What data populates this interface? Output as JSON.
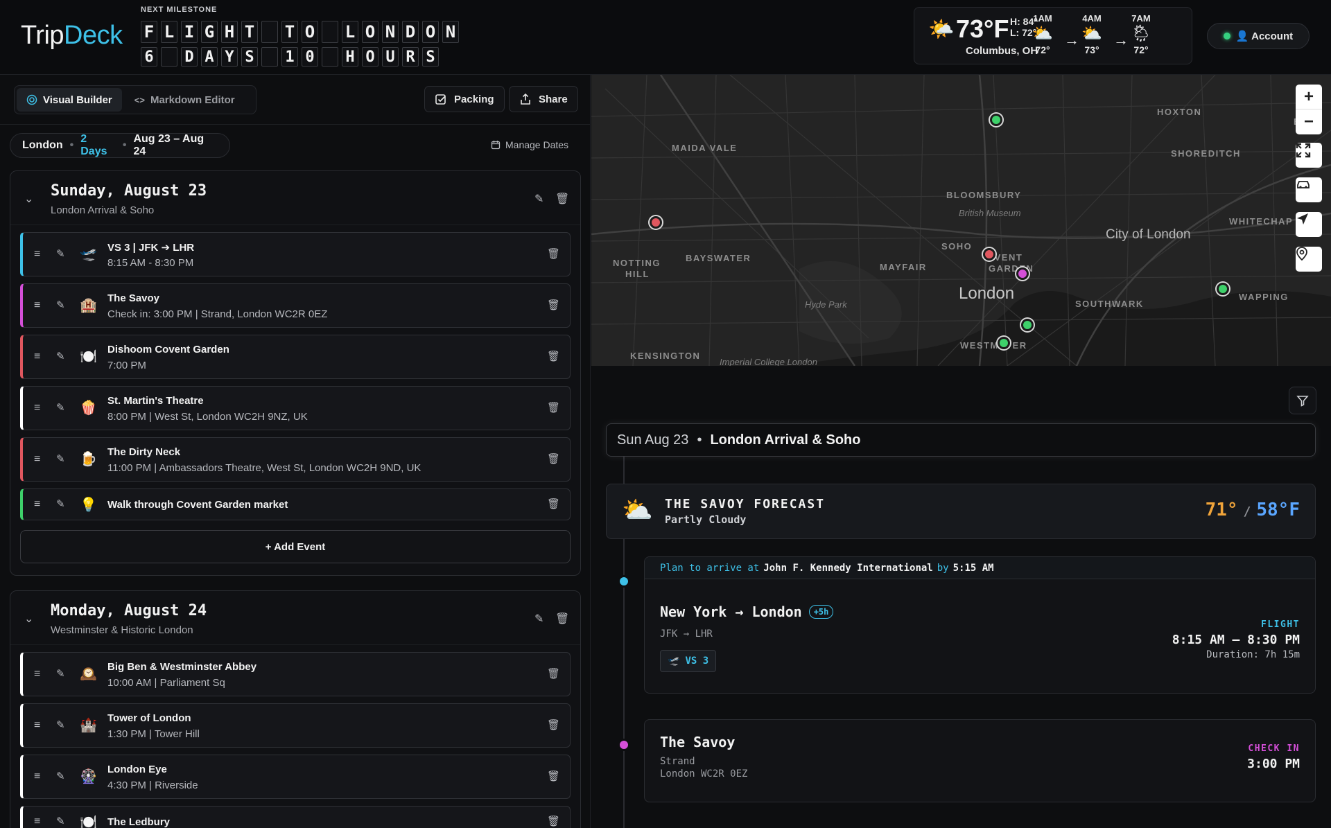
{
  "header": {
    "logo_trip": "Trip",
    "logo_deck": "Deck",
    "milestone_label": "NEXT MILESTONE",
    "milestone_line1": [
      "F",
      "L",
      "I",
      "G",
      "H",
      "T",
      " ",
      "T",
      "O",
      " ",
      "L",
      "O",
      "N",
      "D",
      "O",
      "N"
    ],
    "milestone_line2": [
      "6",
      " ",
      "D",
      "A",
      "Y",
      "S",
      " ",
      "1",
      "0",
      " ",
      "H",
      "O",
      "U",
      "R",
      "S"
    ]
  },
  "weather": {
    "icon": "partly-sunny-icon",
    "temp": "73°F",
    "high": "H: 84°",
    "low": "L: 72°",
    "city": "Columbus, OH",
    "hourly": [
      {
        "time": "1AM",
        "icon": "⛅",
        "temp": "72°"
      },
      {
        "time": "4AM",
        "icon": "⛅",
        "temp": "73°"
      },
      {
        "time": "7AM",
        "icon": "🌦",
        "temp": "72°"
      }
    ],
    "arrow": "→"
  },
  "account": {
    "label": "👤 Account",
    "status_color": "#35d07f"
  },
  "toolbar": {
    "visual_builder": "Visual Builder",
    "markdown_editor": "Markdown Editor",
    "packing": "Packing",
    "share": "Share"
  },
  "trip": {
    "city": "London",
    "days": "2 Days",
    "dates": "Aug 23 – Aug 24",
    "manage_dates": "Manage Dates"
  },
  "days": [
    {
      "title": "Sunday, August 23",
      "subtitle": "London Arrival & Soho",
      "events": [
        {
          "icon": "🛫",
          "title": "VS 3 | JFK ➔ LHR",
          "sub": "8:15 AM - 8:30 PM",
          "color": "#3ec1e8"
        },
        {
          "icon": "🏨",
          "title": "The Savoy",
          "sub": "Check in: 3:00 PM | Strand, London WC2R 0EZ",
          "color": "#d44fd8"
        },
        {
          "icon": "🍽️",
          "title": "Dishoom Covent Garden",
          "sub": "7:00 PM",
          "color": "#e0575f"
        },
        {
          "icon": "🍿",
          "title": "St. Martin's Theatre",
          "sub": "8:00 PM | West St, London WC2H 9NZ, UK",
          "color": "#ffffff"
        },
        {
          "icon": "🍺",
          "title": "The Dirty Neck",
          "sub": "11:00 PM | Ambassadors Theatre, West St, London WC2H 9ND, UK",
          "color": "#e0575f"
        },
        {
          "icon": "💡",
          "title": "Walk through Covent Garden market",
          "sub": "",
          "color": "#3ed06a"
        }
      ],
      "add_event": "+ Add Event"
    },
    {
      "title": "Monday, August 24",
      "subtitle": "Westminster & Historic London",
      "events": [
        {
          "icon": "🕰️",
          "title": "Big Ben & Westminster Abbey",
          "sub": "10:00 AM | Parliament Sq",
          "color": "#ffffff"
        },
        {
          "icon": "🏰",
          "title": "Tower of London",
          "sub": "1:30 PM | Tower Hill",
          "color": "#ffffff"
        },
        {
          "icon": "🎡",
          "title": "London Eye",
          "sub": "4:30 PM | Riverside",
          "color": "#ffffff"
        },
        {
          "icon": "🍽️",
          "title": "The Ledbury",
          "sub": "",
          "color": "#ffffff"
        }
      ]
    }
  ],
  "map": {
    "labels": {
      "maida_vale": "MAIDA VALE",
      "hoxton": "HOXTON",
      "shoreditch": "SHOREDITCH",
      "bloomsbury": "BLOOMSBURY",
      "british_museum": "British Museum",
      "notting_hill_1": "NOTTING",
      "notting_hill_2": "HILL",
      "bayswater": "BAYSWATER",
      "soho": "SOHO",
      "covent_1": "OVENT",
      "covent_2": "GARDEN",
      "mayfair": "MAYFAIR",
      "city_of_london": "City of London",
      "whitechapel": "WHITECHAP",
      "hyde_park": "Hyde Park",
      "london": "London",
      "southwark": "SOUTHWARK",
      "wapping": "WAPPING",
      "kensington": "KENSINGTON",
      "westminster": "WESTMI TER",
      "imperial": "Imperial College London",
      "edge_b": "B"
    },
    "zoom_in": "+",
    "zoom_out": "−",
    "colors": {
      "green": "#3ed06a",
      "red": "#e0575f",
      "magenta": "#d44fd8"
    }
  },
  "timeline": {
    "date": "Sun Aug 23",
    "bullet": "•",
    "day_name": "London Arrival & Soho",
    "forecast": {
      "icon": "⛅",
      "title": "THE SAVOY FORECAST",
      "condition": "Partly Cloudy",
      "high": "71°",
      "slash": "/",
      "low": "58°F"
    },
    "flight": {
      "banner_pre": "Plan to arrive at",
      "banner_airport": "John F. Kennedy International",
      "banner_by": "by",
      "banner_time": "5:15 AM",
      "route": "New York → London",
      "tz": "+5h",
      "codes": "JFK → LHR",
      "flight_no": "VS 3",
      "type": "FLIGHT",
      "time": "8:15 AM – 8:30 PM",
      "duration": "Duration: 7h 15m",
      "color": "#3ec1e8"
    },
    "hotel": {
      "name": "The Savoy",
      "addr1": "Strand",
      "addr2": "London WC2R 0EZ",
      "type": "CHECK IN",
      "time": "3:00 PM",
      "color": "#d44fd8"
    }
  }
}
